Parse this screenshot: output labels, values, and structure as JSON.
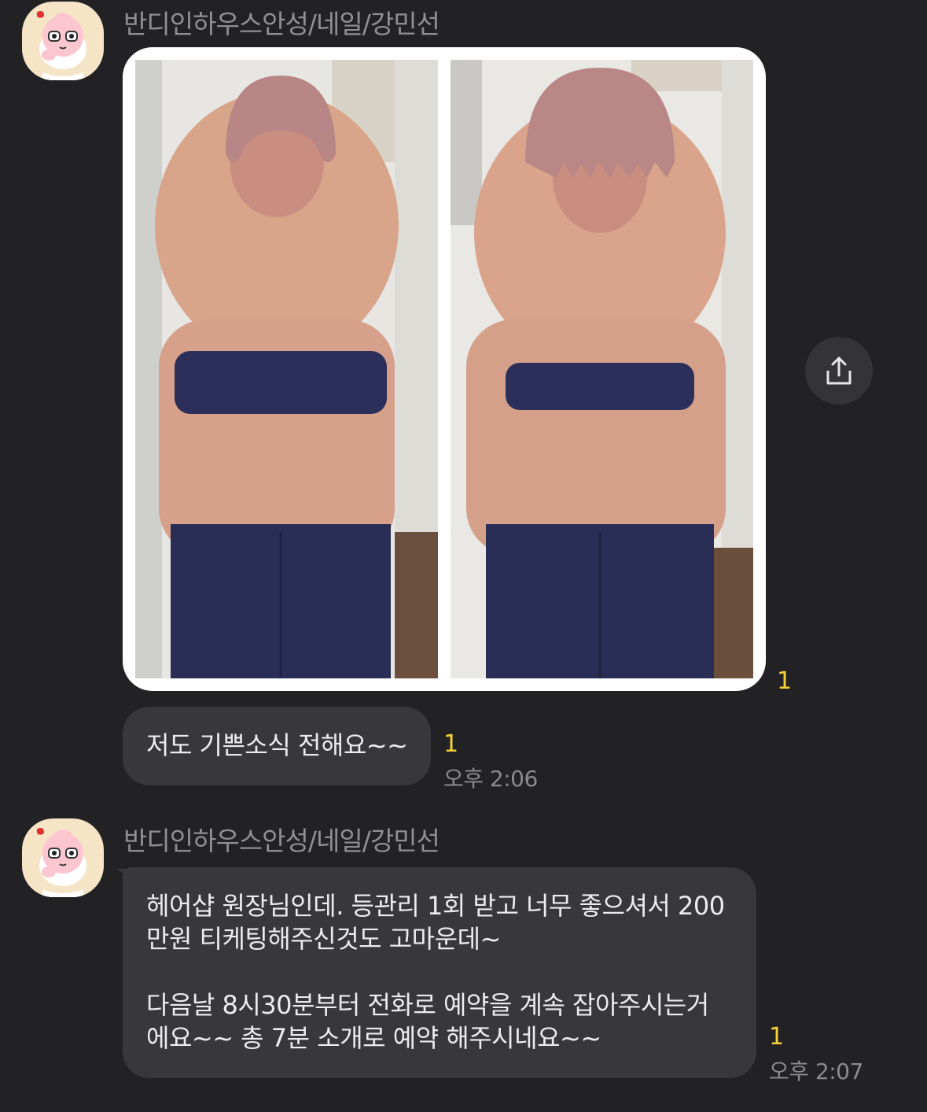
{
  "messages": [
    {
      "sender": "반디인하우스안성/네일/강민선",
      "image_unread": "1",
      "text": "저도 기쁜소식 전해요~~",
      "unread": "1",
      "time": "오후 2:06"
    },
    {
      "sender": "반디인하우스안성/네일/강민선",
      "lines": [
        "헤어샵 원장님인데. 등관리 1회 받고 너무 좋으셔서 200",
        "만원 티케팅해주신것도 고마운데~",
        "",
        "다음날 8시30분부터 전화로 예약을 계속 잡아주시는거",
        "에요~~ 총 7분 소개로 예약 해주시네요~~"
      ],
      "unread": "1",
      "time": "오후 2:07"
    }
  ],
  "icons": {
    "avatar": "peach-character-avatar-icon",
    "share": "share-upload-icon"
  },
  "colors": {
    "background": "#222225",
    "bubble": "#38383c",
    "unread": "#f5d13a"
  }
}
